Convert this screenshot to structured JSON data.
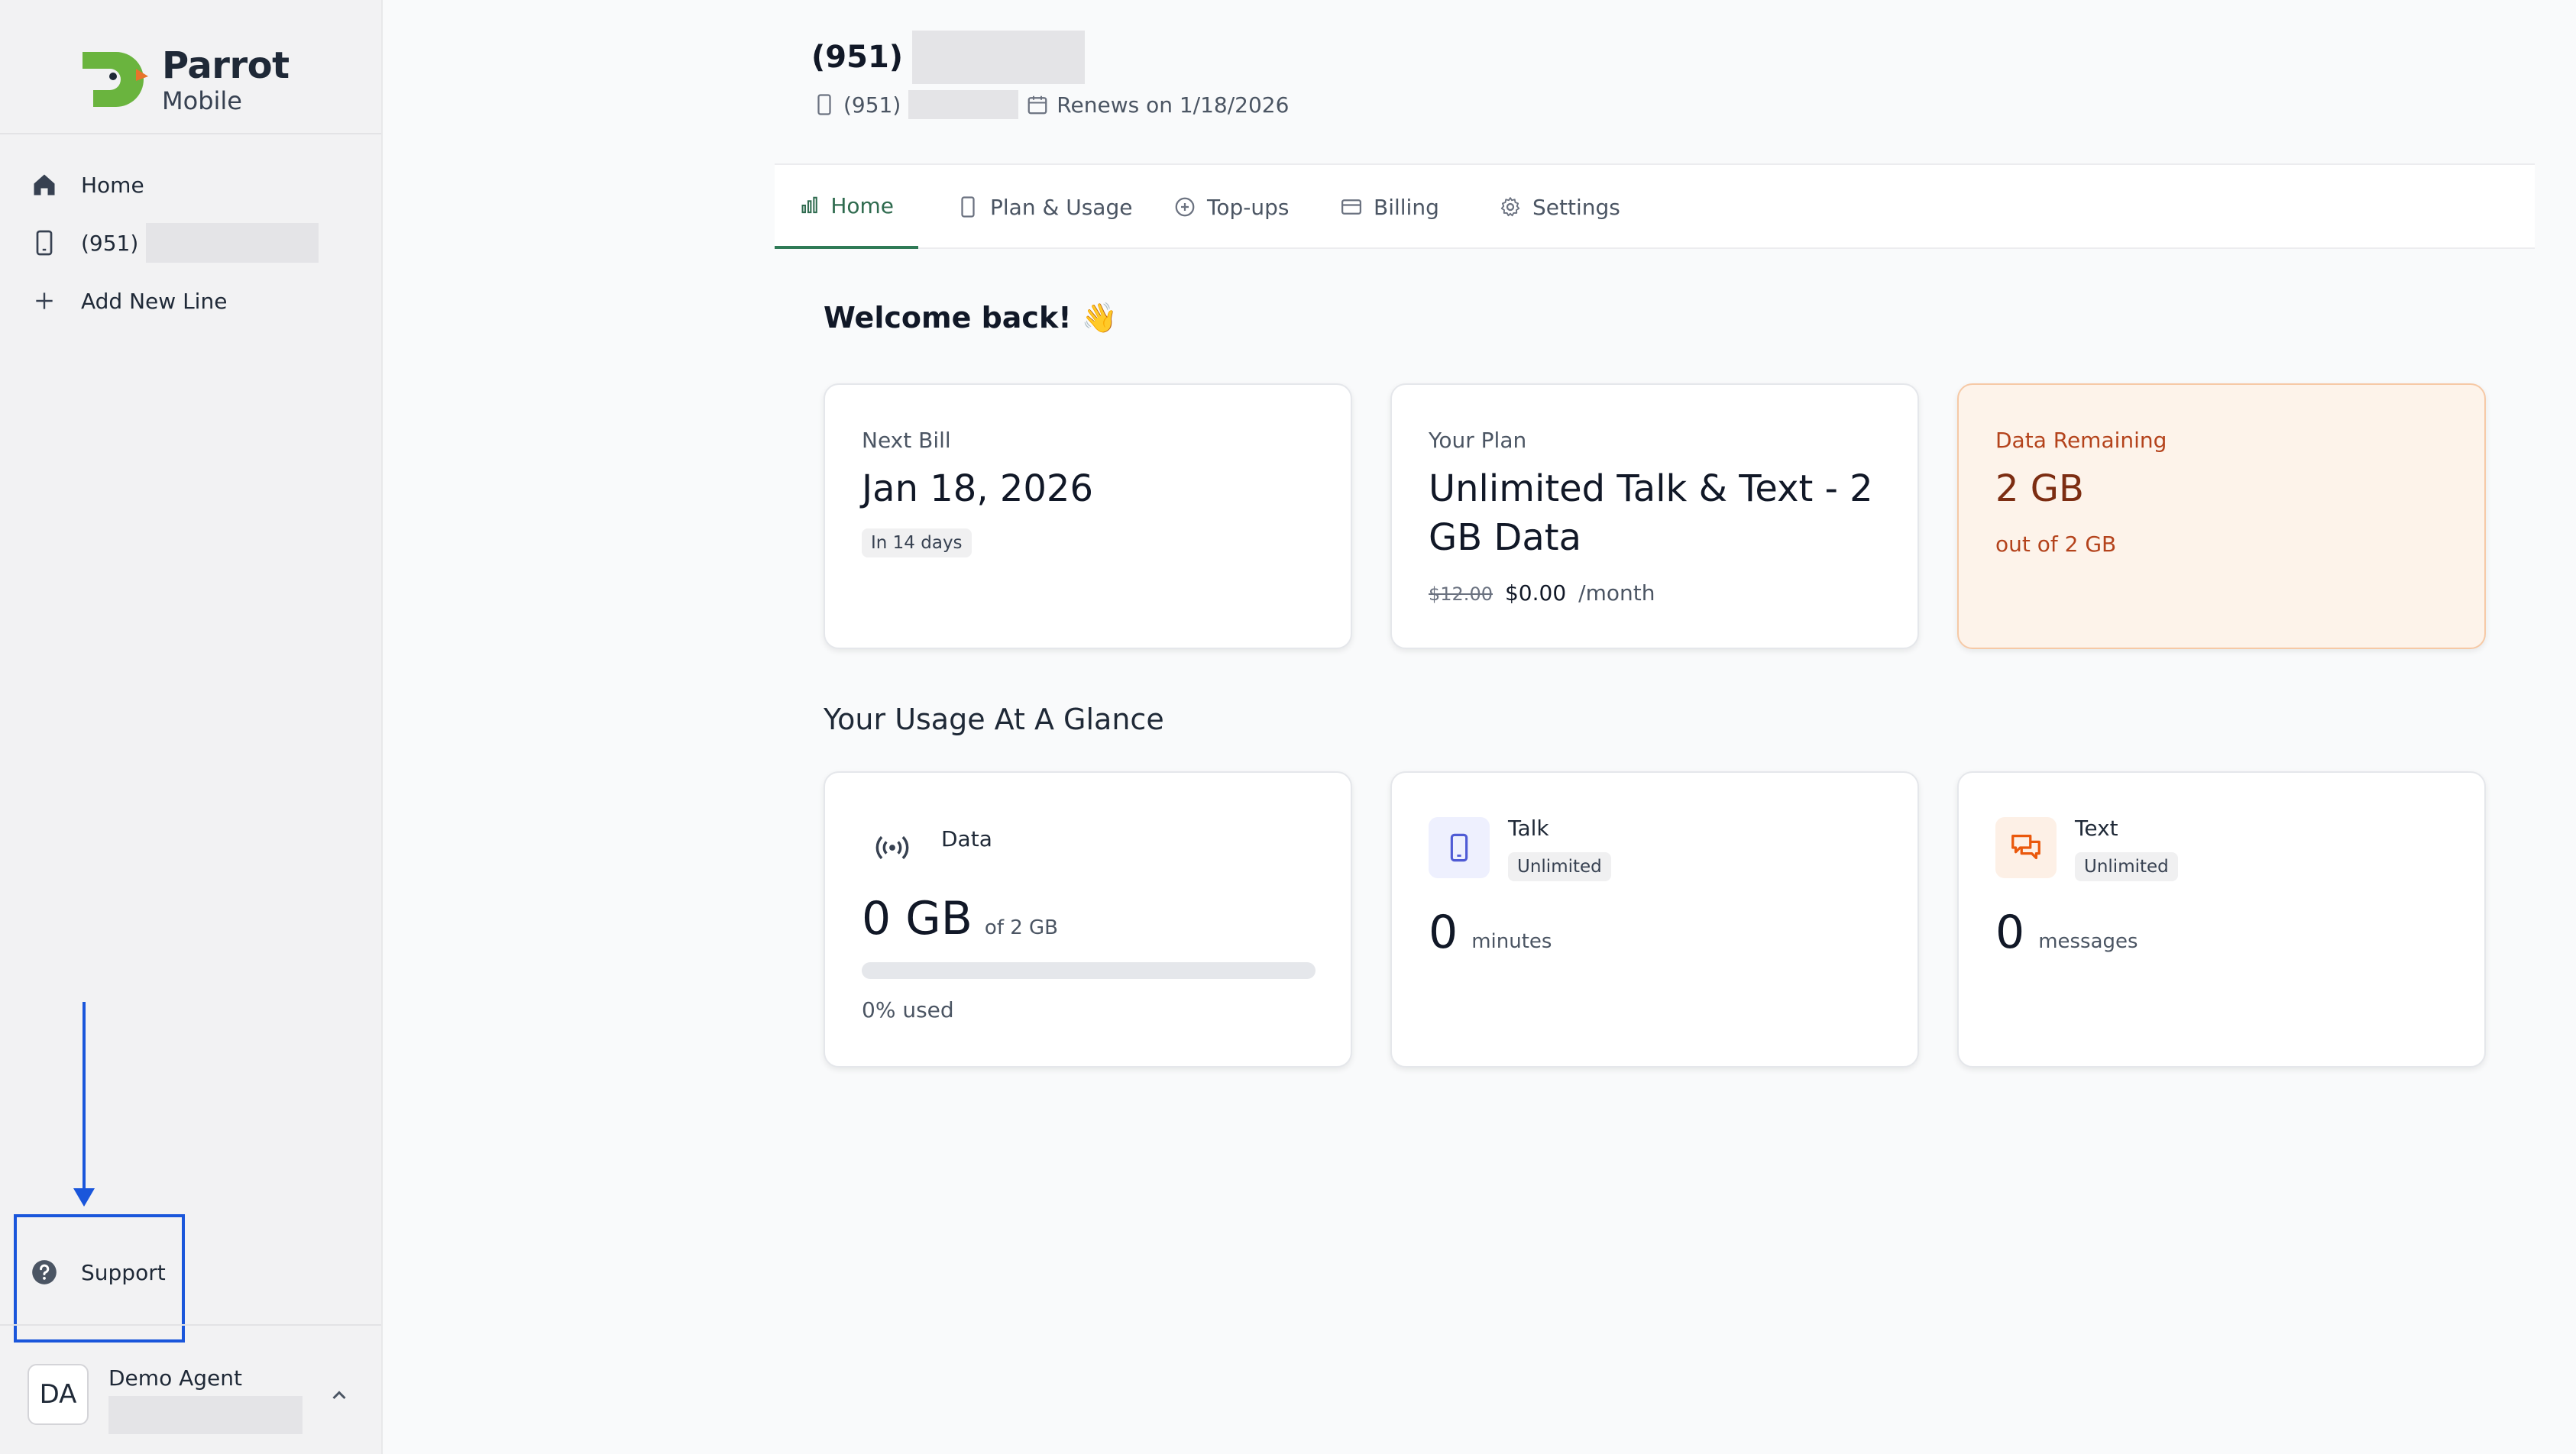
{
  "brand": {
    "name": "Parrot",
    "sub": "Mobile",
    "colors": {
      "green": "#6ab43e",
      "orange": "#e8742b",
      "accent": "#2f7a56"
    }
  },
  "sidebar": {
    "items": [
      {
        "label": "Home",
        "icon": "home-icon"
      },
      {
        "label": "(951)",
        "icon": "phone-icon"
      },
      {
        "label": "Add New Line",
        "icon": "plus-icon"
      }
    ],
    "support": {
      "label": "Support",
      "icon": "question-circle-icon"
    },
    "user": {
      "initials": "DA",
      "name": "Demo Agent"
    }
  },
  "header": {
    "number": "(951)",
    "sub_number": "(951)",
    "renews": "Renews on 1/18/2026"
  },
  "tabs": [
    {
      "label": "Home",
      "icon": "bar-chart-icon",
      "active": true
    },
    {
      "label": "Plan & Usage",
      "icon": "phone-icon"
    },
    {
      "label": "Top-ups",
      "icon": "plus-circle-icon"
    },
    {
      "label": "Billing",
      "icon": "credit-card-icon"
    },
    {
      "label": "Settings",
      "icon": "gear-icon"
    }
  ],
  "welcome": "Welcome back! 👋",
  "summary": {
    "next_bill": {
      "label": "Next Bill",
      "value": "Jan 18, 2026",
      "badge": "In 14 days"
    },
    "plan": {
      "label": "Your Plan",
      "name_line1": "Unlimited Talk & Text - 2",
      "name_line2": "GB Data",
      "old_price": "$12.00",
      "price": "$0.00",
      "per": "/month"
    },
    "data_remaining": {
      "label": "Data Remaining",
      "value": "2 GB",
      "sub": "out of 2 GB"
    }
  },
  "usage_heading": "Your Usage At A Glance",
  "usage": {
    "data": {
      "label": "Data",
      "value": "0 GB",
      "of": "of 2 GB",
      "used_text": "0% used",
      "used_fraction": 0
    },
    "talk": {
      "label": "Talk",
      "badge": "Unlimited",
      "value": "0",
      "unit": "minutes"
    },
    "text": {
      "label": "Text",
      "badge": "Unlimited",
      "value": "0",
      "unit": "messages"
    }
  }
}
